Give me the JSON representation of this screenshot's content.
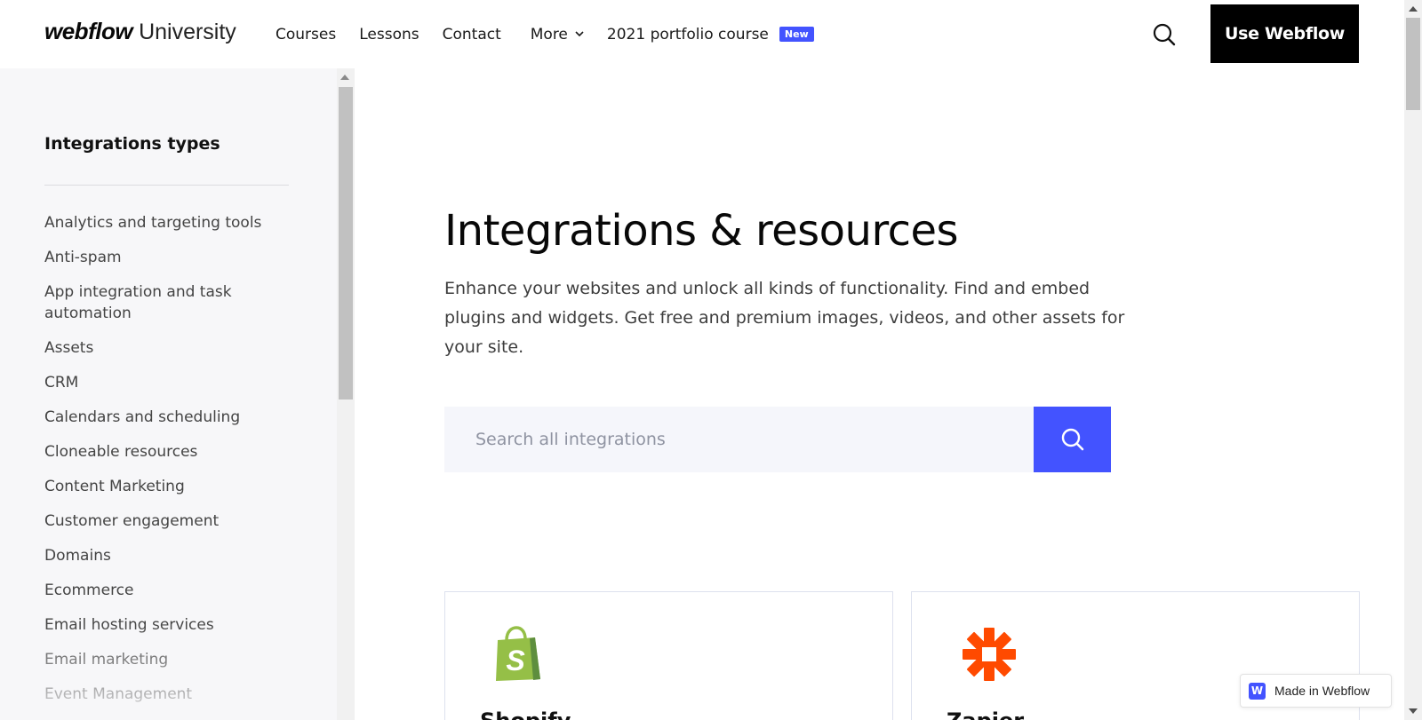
{
  "header": {
    "logo_mark": "webflow",
    "logo_suffix": "University",
    "nav": [
      {
        "label": "Courses"
      },
      {
        "label": "Lessons"
      },
      {
        "label": "Contact"
      },
      {
        "label": "More"
      },
      {
        "label": "2021 portfolio course",
        "badge": "New"
      }
    ],
    "cta_label": "Use Webflow"
  },
  "sidebar": {
    "title": "Integrations types",
    "items": [
      {
        "label": "Analytics and targeting tools"
      },
      {
        "label": "Anti-spam"
      },
      {
        "label": "App integration and task automation"
      },
      {
        "label": "Assets"
      },
      {
        "label": "CRM"
      },
      {
        "label": "Calendars and scheduling"
      },
      {
        "label": "Cloneable resources"
      },
      {
        "label": "Content Marketing"
      },
      {
        "label": "Customer engagement"
      },
      {
        "label": "Domains"
      },
      {
        "label": "Ecommerce"
      },
      {
        "label": "Email hosting services"
      },
      {
        "label": "Email marketing"
      },
      {
        "label": "Event Management"
      }
    ]
  },
  "main": {
    "title": "Integrations & resources",
    "description": "Enhance your websites and unlock all kinds of functionality. Find and embed plugins and widgets. Get free and premium images, videos, and other assets for your site.",
    "search": {
      "placeholder": "Search all integrations",
      "value": ""
    },
    "cards": [
      {
        "name": "Shopify",
        "icon": "shopify-bag-icon",
        "color": "#95bf47"
      },
      {
        "name": "Zapier",
        "icon": "zapier-asterisk-icon",
        "color": "#ff4a00"
      }
    ]
  },
  "badge": {
    "label": "Made in Webflow",
    "icon": "webflow-w-icon",
    "icon_letter": "W"
  },
  "colors": {
    "accent": "#4353ff",
    "cta_bg": "#000000",
    "sidebar_bg": "#f7f7f9"
  }
}
